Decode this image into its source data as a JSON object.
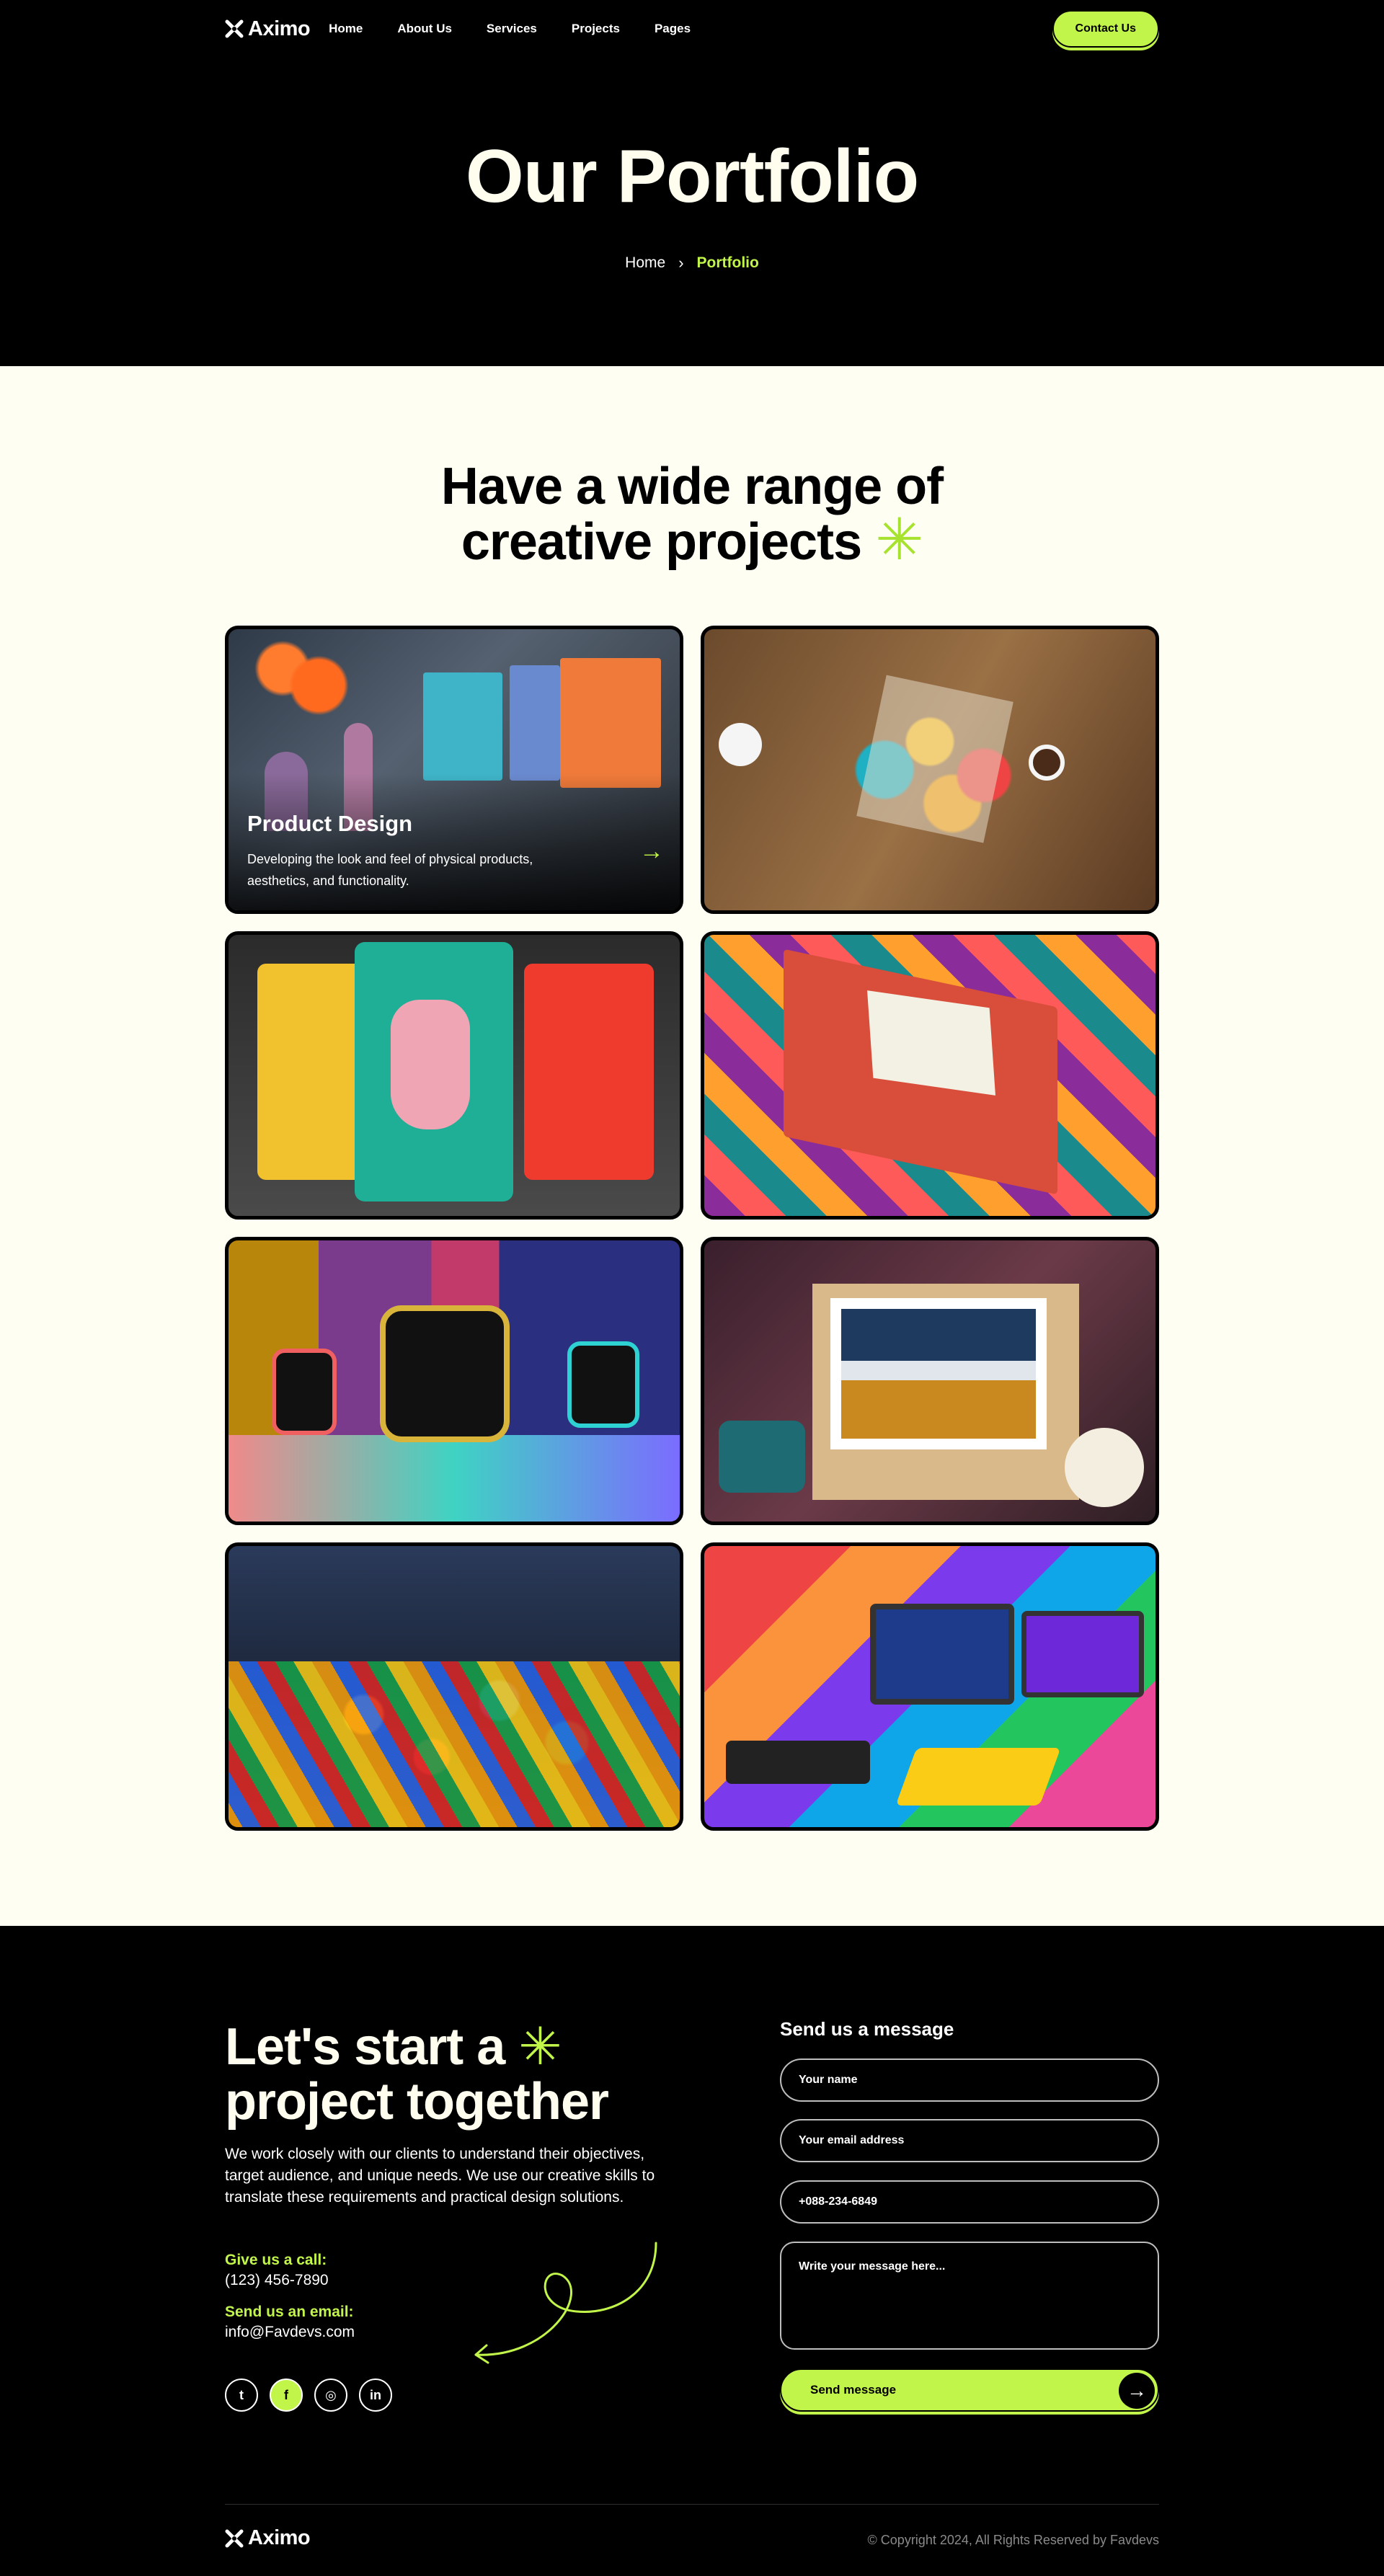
{
  "nav": {
    "logo_text": "Aximo",
    "links": [
      "Home",
      "About Us",
      "Services",
      "Projects",
      "Pages"
    ],
    "contact_label": "Contact Us"
  },
  "hero": {
    "title": "Our Portfolio",
    "breadcrumb": {
      "home": "Home",
      "separator": "›",
      "current": "Portfolio"
    }
  },
  "portfolio": {
    "heading_line1": "Have a wide range of",
    "heading_line2": "creative projects",
    "heading_star": "✳",
    "cards": [
      {
        "name": "product-design",
        "title": "Product Design",
        "description": "Developing the look and feel of physical products, aesthetics, and functionality.",
        "arrow": "→"
      },
      {
        "name": "collage-workshop"
      },
      {
        "name": "coffee-packaging"
      },
      {
        "name": "gift-box-packaging"
      },
      {
        "name": "smartwatch-display"
      },
      {
        "name": "flatlay-composition"
      },
      {
        "name": "puzzle-pieces"
      },
      {
        "name": "devices-showcase"
      }
    ]
  },
  "contact": {
    "title_line1": "Let's start a",
    "title_star": "✳",
    "title_line2": "project together",
    "description": "We work closely with our clients to understand their objectives, target audience, and unique needs. We use our creative skills to translate these requirements and practical design solutions.",
    "call_label": "Give us a call:",
    "call_value": "(123) 456-7890",
    "email_label": "Send us an email:",
    "email_value": "info@Favdevs.com",
    "socials": [
      "twitter-icon",
      "facebook-icon",
      "instagram-icon",
      "linkedin-icon"
    ],
    "form": {
      "title": "Send us a message",
      "name_placeholder": "Your name",
      "email_placeholder": "Your email address",
      "phone_placeholder": "+088-234-6849",
      "message_placeholder": "Write your message here...",
      "send_label": "Send message"
    }
  },
  "footer": {
    "logo_text": "Aximo",
    "copyright": "© Copyright 2024, All Rights Reserved by Favdevs"
  },
  "colors": {
    "accent": "#c2f54a",
    "cream": "#fefef3",
    "dark": "#000000"
  }
}
